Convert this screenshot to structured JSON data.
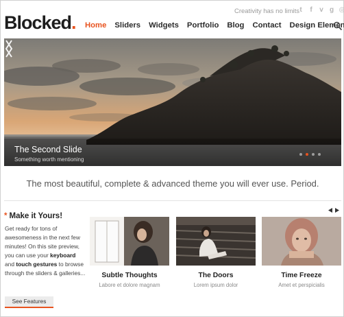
{
  "header": {
    "logo": "Blocked",
    "logo_dot": ".",
    "tagline": "Creativity has no limits",
    "social_icons": [
      "twitter-icon",
      "facebook-icon",
      "vimeo-icon",
      "google-plus-icon",
      "dribbble-icon"
    ],
    "nav": [
      "Home",
      "Sliders",
      "Widgets",
      "Portfolio",
      "Blog",
      "Contact",
      "Design Elements"
    ],
    "active_nav": "Home"
  },
  "slider": {
    "title": "The Second Slide",
    "subtitle": "Something worth mentioning",
    "slide_count": 4,
    "active_slide": 2
  },
  "banner": {
    "text": "The most beautiful, complete & advanced theme you will ever use. Period."
  },
  "promo": {
    "title": "Make it Yours!",
    "body_1": "Get ready for tons of awesomeness in the next few minutes! On this site preview, you can use your ",
    "keyboard": "keyboard",
    "body_2": " and ",
    "touch": "touch gestures",
    "body_3": " to browse through the sliders & galleries...",
    "button": "See Features"
  },
  "portfolio": [
    {
      "title": "Subtle Thoughts",
      "subtitle": "Labore et dolore magnam"
    },
    {
      "title": "The Doors",
      "subtitle": "Lorem ipsum dolor"
    },
    {
      "title": "Time Freeze",
      "subtitle": "Amet et perspicialis"
    }
  ],
  "colors": {
    "accent": "#e8531f",
    "text": "#222222",
    "muted": "#888888"
  }
}
